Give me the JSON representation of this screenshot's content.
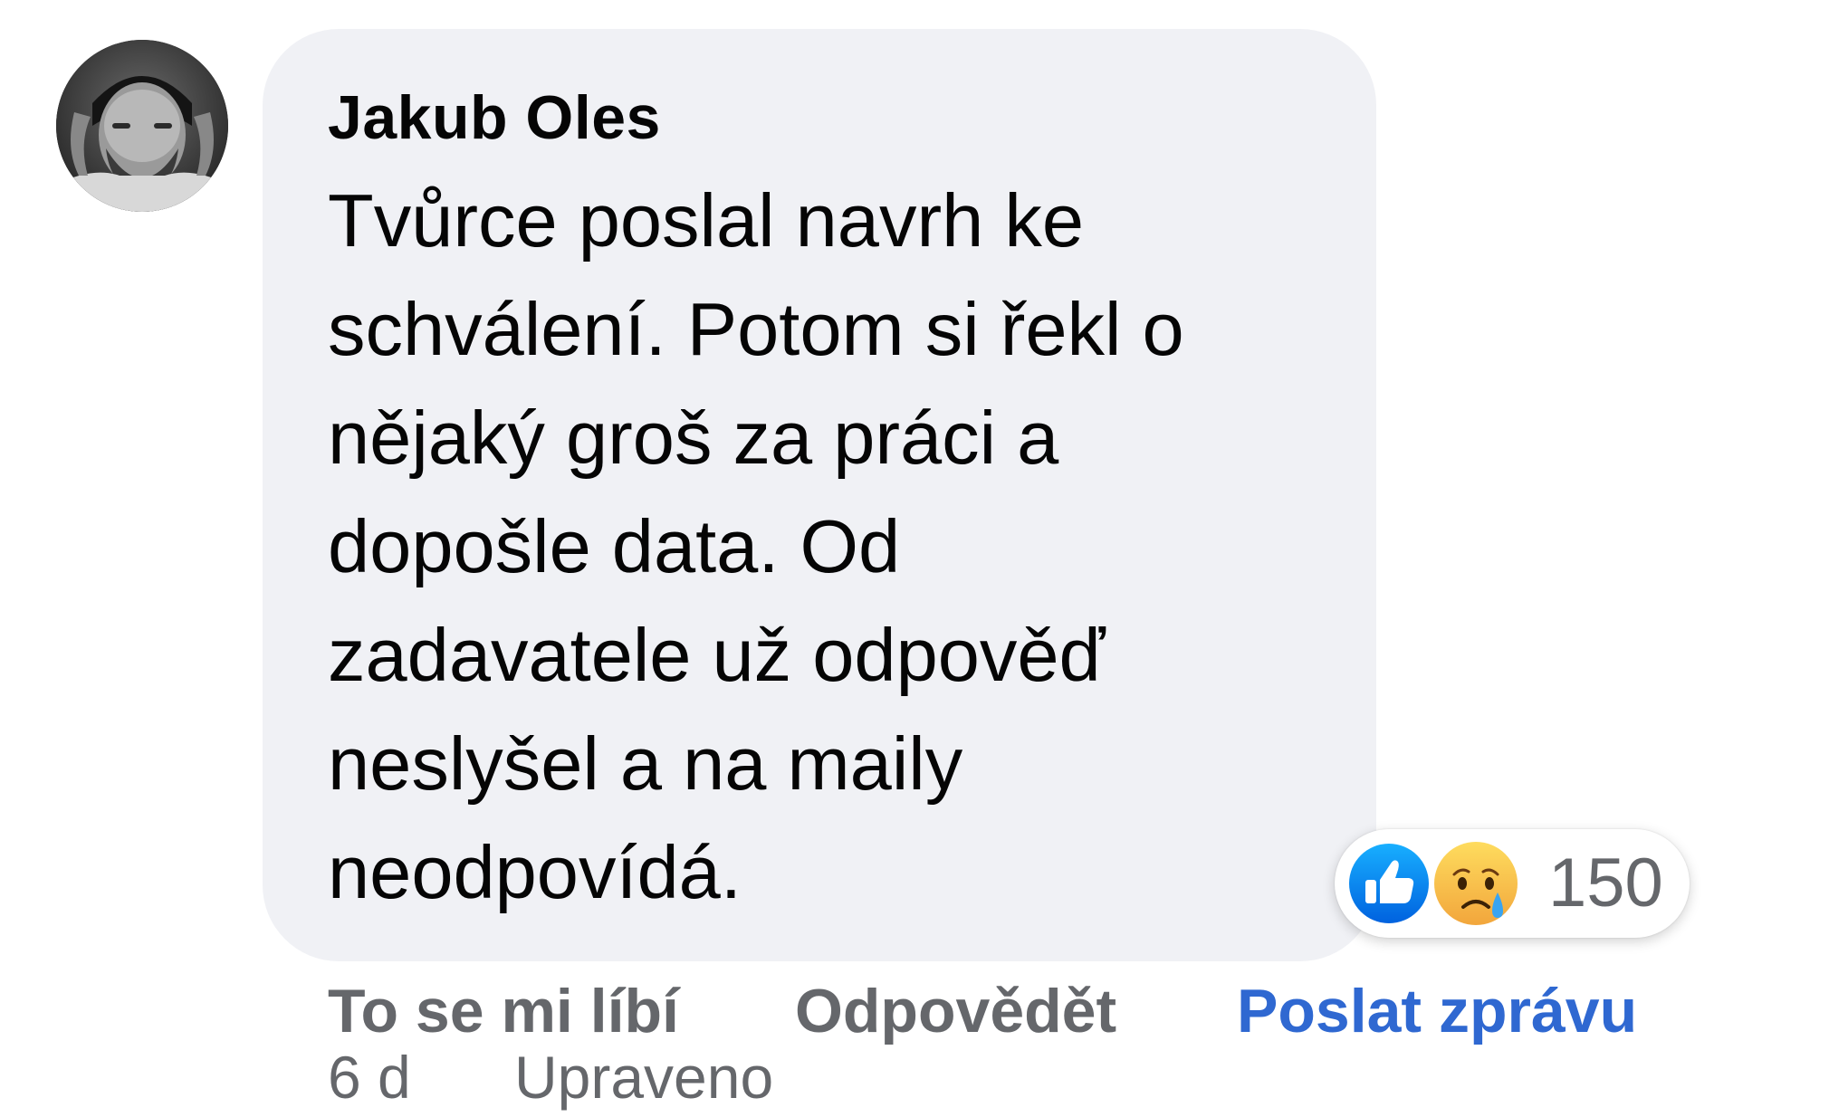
{
  "comment": {
    "author": "Jakub Oles",
    "text_lines": [
      "Tvůrce poslal navrh ke",
      "schválení. Potom si řekl o",
      "nějaký groš za práci a",
      "dopošle data. Od",
      "zadavatele už odpověď",
      "neslyšel a na maily",
      "neodpovídá."
    ],
    "avatar_icon": "profile-photo"
  },
  "reactions": {
    "types": [
      "like-icon",
      "sad-icon"
    ],
    "count": "150",
    "like_color": "#1877f2",
    "sad_color": "#f7b125"
  },
  "actions": {
    "like_label": "To se mi líbí",
    "reply_label": "Odpovědět",
    "message_label": "Poslat zprávu",
    "message_color": "#2f68d1"
  },
  "meta": {
    "time": "6 d",
    "edited_label": "Upraveno"
  },
  "colors": {
    "bubble_background": "#f0f1f5",
    "secondary_text": "#65676b",
    "primary_text": "#050505"
  }
}
